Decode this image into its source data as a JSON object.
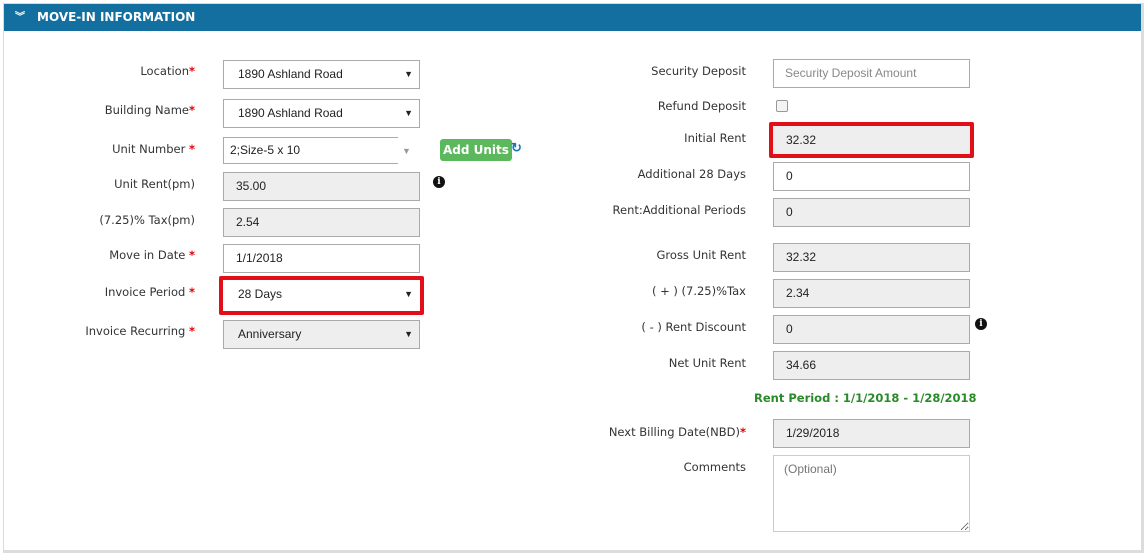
{
  "header": {
    "title": "MOVE-IN INFORMATION",
    "collapse_icon": "double-chevron-down-icon"
  },
  "left": {
    "location": {
      "label": "Location",
      "required": "*",
      "value": "1890 Ashland Road"
    },
    "building_name": {
      "label": "Building Name",
      "required": "*",
      "value": "1890 Ashland Road"
    },
    "unit_number": {
      "label": "Unit Number",
      "required": "*",
      "value": "2;Size-5 x 10"
    },
    "add_units_label": "Add Units",
    "unit_rent": {
      "label": "Unit Rent(pm)",
      "value": "35.00"
    },
    "tax": {
      "label": "(7.25)% Tax(pm)",
      "value": "2.54"
    },
    "move_in_date": {
      "label": "Move in Date",
      "required": "*",
      "value": "1/1/2018"
    },
    "invoice_period": {
      "label": "Invoice Period",
      "required": "*",
      "value": "28 Days"
    },
    "invoice_recurring": {
      "label": "Invoice Recurring",
      "required": "*",
      "value": "Anniversary"
    }
  },
  "right": {
    "security_deposit": {
      "label": "Security Deposit",
      "placeholder": "Security Deposit Amount"
    },
    "refund_deposit": {
      "label": "Refund Deposit",
      "checked": false
    },
    "initial_rent": {
      "label": "Initial Rent",
      "value": "32.32"
    },
    "additional_days": {
      "label": "Additional 28 Days",
      "value": "0"
    },
    "rent_additional_periods": {
      "label": "Rent:Additional Periods",
      "value": "0"
    },
    "gross_unit_rent": {
      "label": "Gross Unit Rent",
      "value": "32.32"
    },
    "plus_tax": {
      "label": "( + ) (7.25)%Tax",
      "value": "2.34"
    },
    "rent_discount": {
      "label": "( - ) Rent Discount",
      "value": "0"
    },
    "net_unit_rent": {
      "label": "Net Unit Rent",
      "value": "34.66"
    },
    "rent_period": "Rent Period : 1/1/2018 - 1/28/2018",
    "next_billing_date": {
      "label": "Next Billing Date(NBD)",
      "required": "*",
      "value": "1/29/2018"
    },
    "comments": {
      "label": "Comments",
      "placeholder": "(Optional)"
    }
  },
  "colors": {
    "header_bg": "#126fa0",
    "highlight": "#e10f17",
    "add_button": "#5cb85c",
    "rent_period": "#2a8a2a"
  }
}
